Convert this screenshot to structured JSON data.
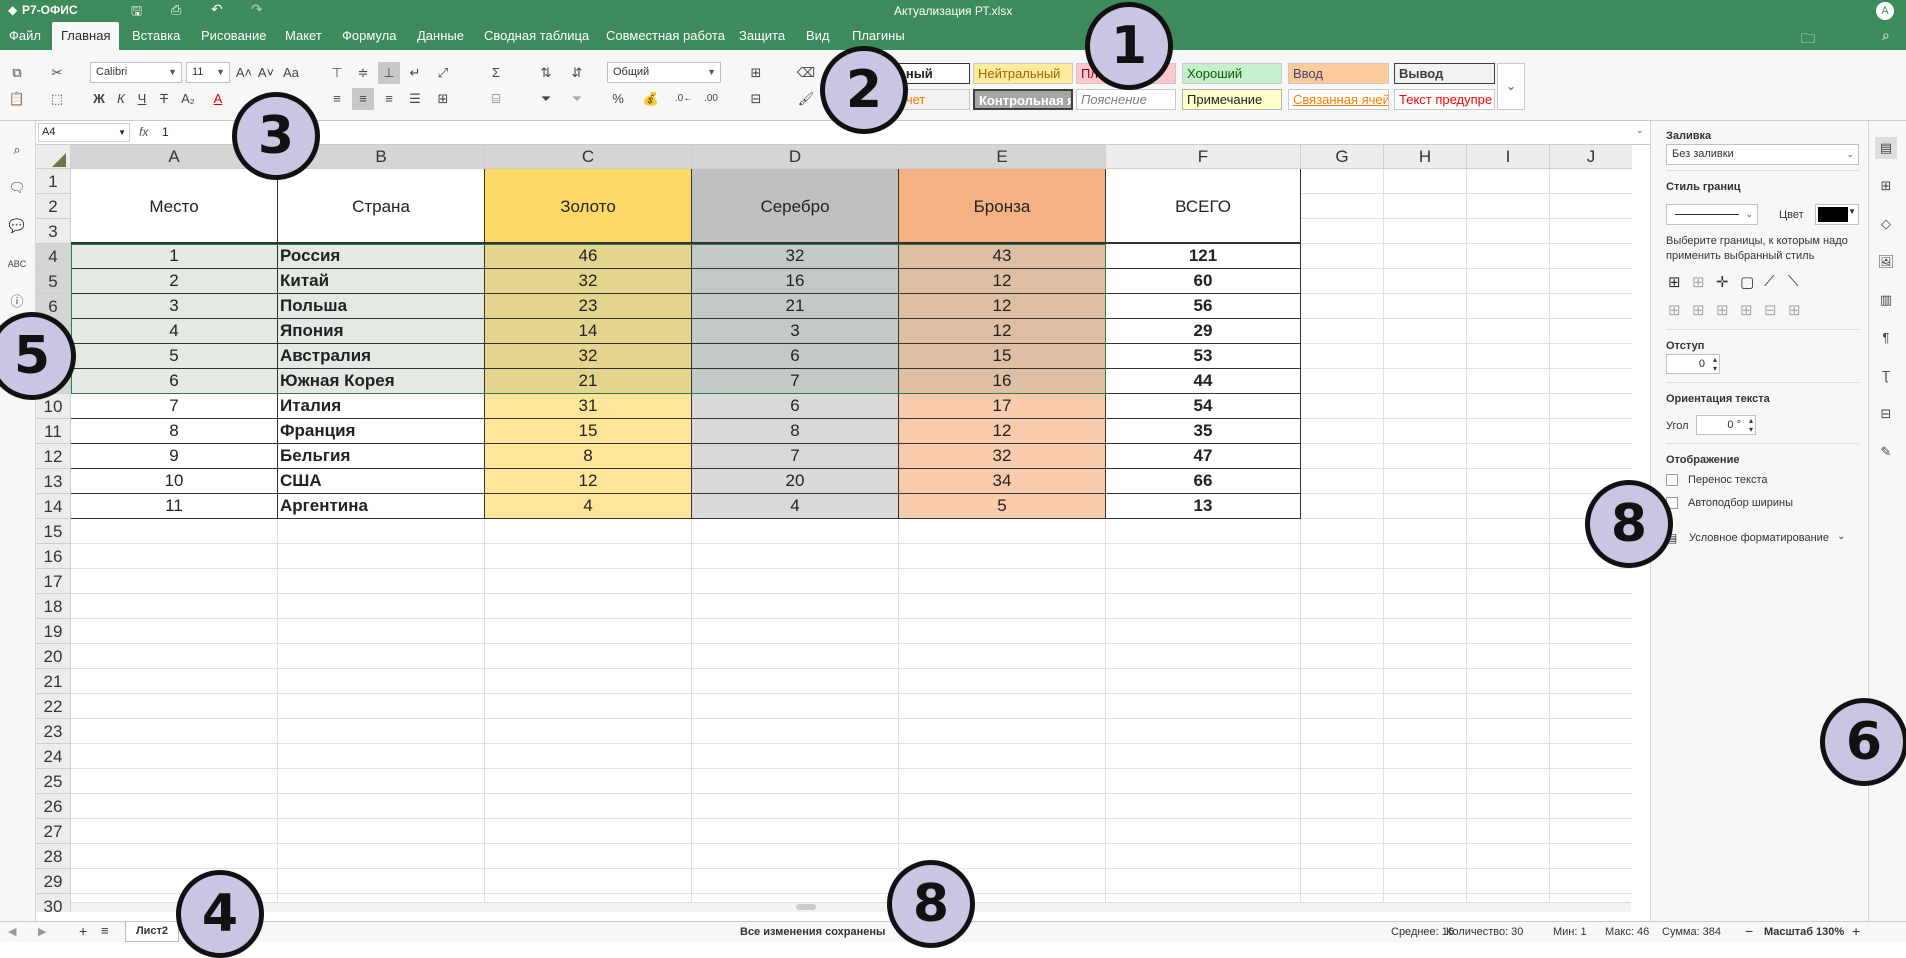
{
  "app_title": "Р7-ОФИС",
  "doc_title": "Актуализация РТ.xlsx",
  "user_initial": "А",
  "menu_tabs": [
    "Файл",
    "Главная",
    "Вставка",
    "Рисование",
    "Макет",
    "Формула",
    "Данные",
    "Сводная таблица",
    "Совместная работа",
    "Защита",
    "Вид",
    "Плагины"
  ],
  "ribbon": {
    "font_name": "Calibri",
    "font_size": "11",
    "number_format": "Общий"
  },
  "cell_styles_row1": [
    "...ный",
    "Нейтральный",
    "Пл...",
    "Хороший",
    "Ввод",
    "Вывод"
  ],
  "cell_styles_row2": [
    "...чет",
    "Контрольная я",
    "Пояснение",
    "Примечание",
    "Связанная ячей",
    "Текст предупре"
  ],
  "formula_bar": {
    "name_box": "A4",
    "fx": "fx",
    "value": "1"
  },
  "columns": [
    "A",
    "B",
    "C",
    "D",
    "E",
    "F",
    "G",
    "H",
    "I",
    "J"
  ],
  "rows": [
    "1",
    "2",
    "3",
    "4",
    "5",
    "6",
    "7",
    "8",
    "9",
    "10",
    "11",
    "12",
    "13",
    "14",
    "15",
    "16",
    "17",
    "18",
    "19",
    "20",
    "21",
    "22",
    "23",
    "24",
    "25",
    "26",
    "27",
    "28",
    "29",
    "30"
  ],
  "table": {
    "headers": [
      "Место",
      "Страна",
      "Золото",
      "Серебро",
      "Бронза",
      "ВСЕГО"
    ],
    "data": [
      [
        "1",
        "Россия",
        "46",
        "32",
        "43",
        "121"
      ],
      [
        "2",
        "Китай",
        "32",
        "16",
        "12",
        "60"
      ],
      [
        "3",
        "Польша",
        "23",
        "21",
        "12",
        "56"
      ],
      [
        "4",
        "Япония",
        "14",
        "3",
        "12",
        "29"
      ],
      [
        "5",
        "Австралия",
        "32",
        "6",
        "15",
        "53"
      ],
      [
        "6",
        "Южная Корея",
        "21",
        "7",
        "16",
        "44"
      ],
      [
        "7",
        "Италия",
        "31",
        "6",
        "17",
        "54"
      ],
      [
        "8",
        "Франция",
        "15",
        "8",
        "12",
        "35"
      ],
      [
        "9",
        "Бельгия",
        "8",
        "7",
        "32",
        "47"
      ],
      [
        "10",
        "США",
        "12",
        "20",
        "34",
        "66"
      ],
      [
        "11",
        "Аргентина",
        "4",
        "4",
        "5",
        "13"
      ]
    ]
  },
  "colors": {
    "brand_green": "#3d8a5c",
    "gold": "#ffd966",
    "silver": "#bfbfbf",
    "bronze": "#f4b183",
    "gold_light": "#fee599",
    "silver_light": "#d9d9d9",
    "bronze_light": "#f8cbad"
  },
  "right_panel": {
    "fill_title": "Заливка",
    "fill_value": "Без заливки",
    "border_style_title": "Стиль границ",
    "color_label": "Цвет",
    "border_hint": "Выберите границы, к которым надо применить выбранный стиль",
    "indent_title": "Отступ",
    "indent_value": "0",
    "orientation_title": "Ориентация текста",
    "angle_label": "Угол",
    "angle_value": "0 °",
    "display_title": "Отображение",
    "wrap_text": "Перенос текста",
    "autofit": "Автоподбор ширины",
    "conditional": "Условное форматирование"
  },
  "status": {
    "sheet_tab": "Лист2",
    "saved": "Все изменения сохранены",
    "average": "Среднее: 16",
    "count": "Количество: 30",
    "min": "Мин: 1",
    "max": "Макс: 46",
    "sum": "Сумма: 384",
    "zoom": "Масштаб 130%"
  },
  "callouts": [
    "1",
    "2",
    "3",
    "4",
    "5",
    "6",
    "8",
    "8"
  ]
}
